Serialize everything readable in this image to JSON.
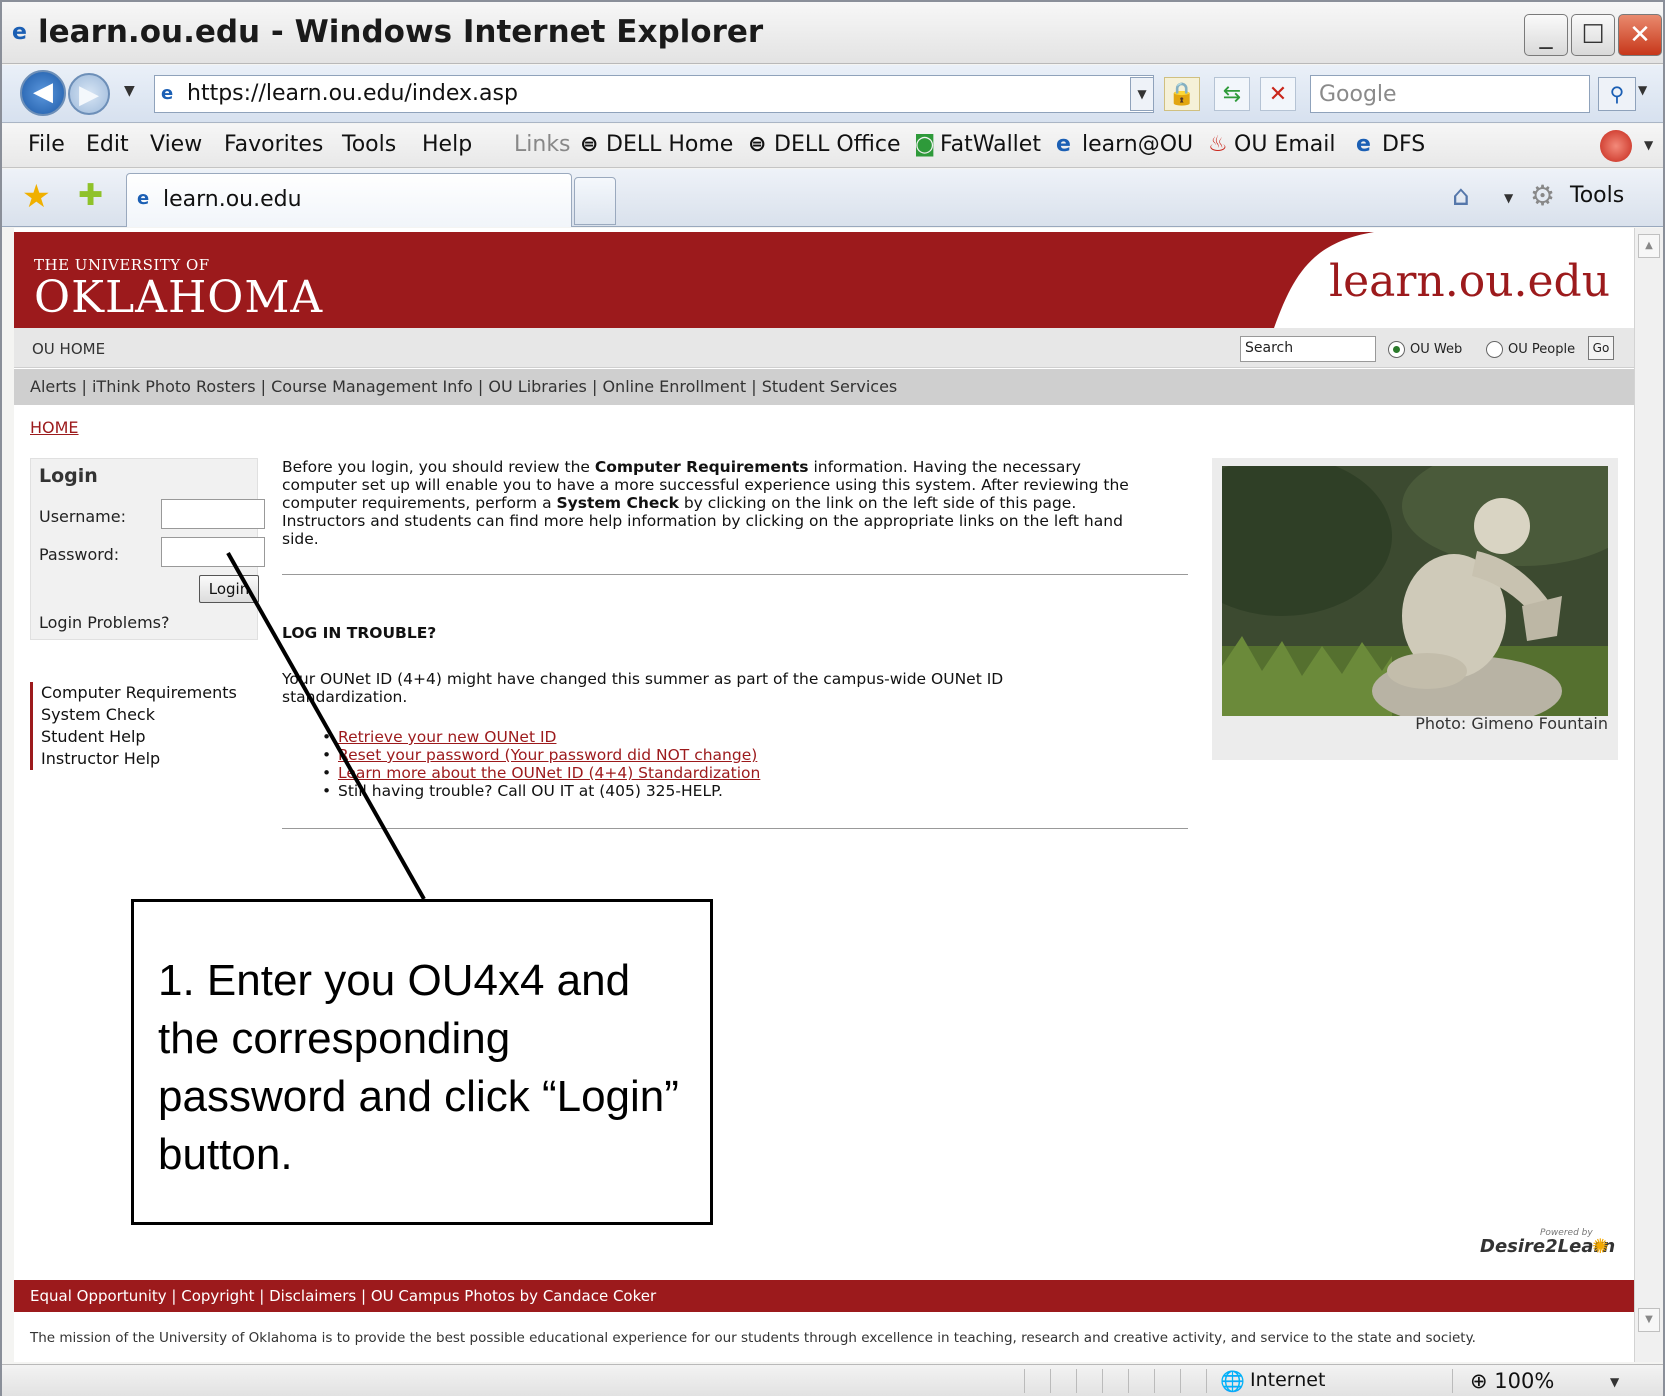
{
  "window": {
    "title": "learn.ou.edu - Windows Internet Explorer"
  },
  "address": {
    "url": "https://learn.ou.edu/index.asp",
    "search_placeholder": "Google"
  },
  "menu": {
    "items": [
      "File",
      "Edit",
      "View",
      "Favorites",
      "Tools",
      "Help"
    ]
  },
  "links_bar": {
    "label": "Links",
    "items": [
      "DELL Home",
      "DELL Office",
      "FatWallet",
      "learn@OU",
      "OU Email",
      "DFS"
    ]
  },
  "tabs": {
    "active_label": "learn.ou.edu",
    "tools_label": "Tools"
  },
  "header": {
    "logo_small": "THE UNIVERSITY OF",
    "logo_big": "OKLAHOMA",
    "site_name": "learn.ou.edu"
  },
  "subnav": {
    "home": "OU HOME",
    "search_value": "Search",
    "radio_web": "OU Web",
    "radio_people": "OU People",
    "go": "Go"
  },
  "quicklinks": "Alerts | iThink Photo Rosters | Course Management Info | OU Libraries | Online Enrollment | Student Services",
  "breadcrumb": "HOME",
  "login": {
    "title": "Login",
    "username_label": "Username:",
    "password_label": "Password:",
    "button": "Login",
    "problems": "Login Problems?"
  },
  "leftnav": [
    "Computer Requirements",
    "System Check",
    "Student Help",
    "Instructor Help"
  ],
  "intro": {
    "p1": "Before you login, you should review the ",
    "b1": "Computer Requirements",
    "p2": " information. Having the necessary computer set up will enable you to have a more successful experience using this system. After reviewing the computer requirements, perform a ",
    "b2": "System Check",
    "p3": " by clicking on the link on the left side of this page. Instructors and students can find more help information by clicking on the appropriate links on the left hand side."
  },
  "trouble": {
    "title": "LOG IN TROUBLE?",
    "text": "Your OUNet ID (4+4) might have changed this summer as part of the campus-wide OUNet ID standardization.",
    "links": [
      "Retrieve your new OUNet ID",
      "Reset your password (Your password did NOT change)",
      "Learn more about the OUNet ID (4+4) Standardization"
    ],
    "last": "Still having trouble? Call OU IT at (405) 325-HELP."
  },
  "photo": {
    "caption": "Photo: Gimeno Fountain"
  },
  "d2l": {
    "powered": "Powered by",
    "name": "Desire2Learn"
  },
  "footer": {
    "links": "Equal Opportunity | Copyright | Disclaimers | OU Campus Photos by Candace Coker",
    "mission": "The mission of the University of Oklahoma is to provide the best possible educational experience for our students through excellence in teaching, research and creative activity, and service to the state and society."
  },
  "callout": {
    "text": "1. Enter you OU4x4 and the corresponding password and click “Login” button."
  },
  "status": {
    "zone": "Internet",
    "zoom": "100%"
  },
  "colors": {
    "ou_crimson": "#9c1a1c"
  }
}
